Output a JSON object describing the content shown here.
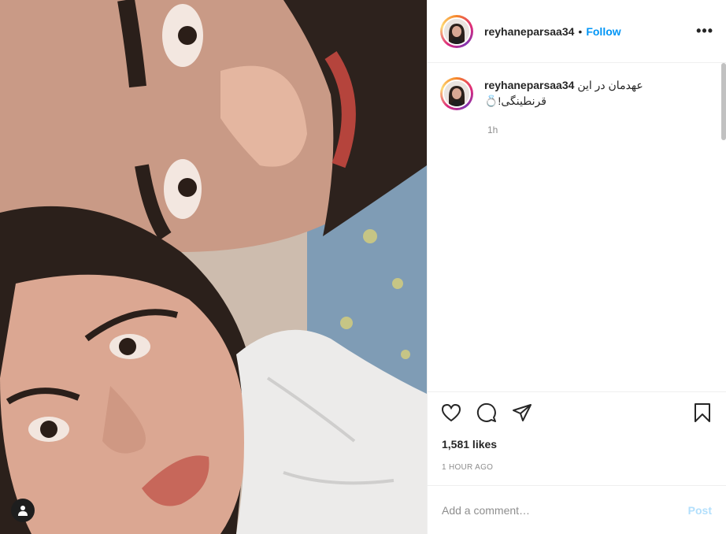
{
  "post": {
    "username": "reyhaneparsaa34",
    "separator": "•",
    "follow_label": "Follow",
    "more_label": "•••",
    "caption_text": "عهدمان در این قرنطینگی!💍",
    "caption_time": "1h",
    "likes": "1,581 likes",
    "posted_ago": "1 HOUR AGO",
    "comment_placeholder": "Add a comment…",
    "post_label": "Post"
  },
  "colors": {
    "accent": "#0095f6",
    "post_disabled": "#b2dffc",
    "secondary_text": "#8e8e8e"
  },
  "icons": [
    "user-tag-icon",
    "heart-icon",
    "comment-icon",
    "share-icon",
    "bookmark-icon",
    "more-icon"
  ]
}
